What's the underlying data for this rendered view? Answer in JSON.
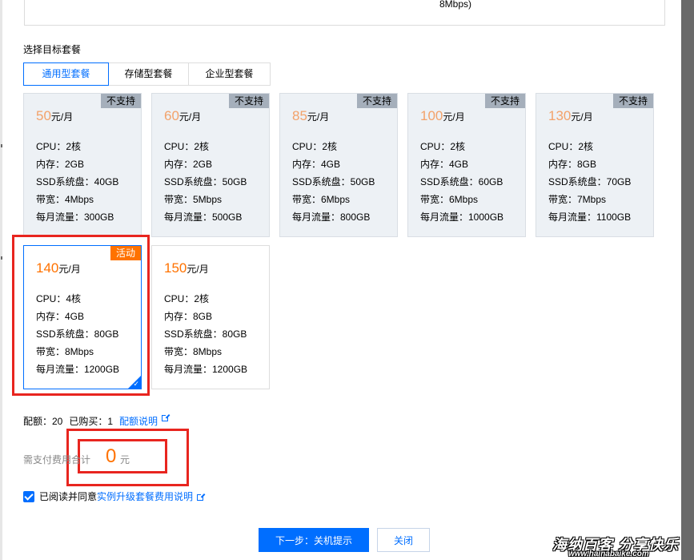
{
  "top_box": {
    "text": "8Mbps)"
  },
  "section_label": "选择目标套餐",
  "tabs": [
    {
      "label": "通用型套餐",
      "active": true
    },
    {
      "label": "存储型套餐",
      "active": false
    },
    {
      "label": "企业型套餐",
      "active": false
    }
  ],
  "plans": [
    {
      "price": "50",
      "unit": "元/月",
      "badge": "不支持",
      "cpu": "CPU：2核",
      "mem": "内存：2GB",
      "ssd": "SSD系统盘：40GB",
      "bw": "带宽：4Mbps",
      "traffic": "每月流量：300GB",
      "state": "disabled"
    },
    {
      "price": "60",
      "unit": "元/月",
      "badge": "不支持",
      "cpu": "CPU：2核",
      "mem": "内存：2GB",
      "ssd": "SSD系统盘：50GB",
      "bw": "带宽：5Mbps",
      "traffic": "每月流量：500GB",
      "state": "disabled"
    },
    {
      "price": "85",
      "unit": "元/月",
      "badge": "不支持",
      "cpu": "CPU：2核",
      "mem": "内存：4GB",
      "ssd": "SSD系统盘：50GB",
      "bw": "带宽：6Mbps",
      "traffic": "每月流量：800GB",
      "state": "disabled"
    },
    {
      "price": "100",
      "unit": "元/月",
      "badge": "不支持",
      "cpu": "CPU：2核",
      "mem": "内存：4GB",
      "ssd": "SSD系统盘：60GB",
      "bw": "带宽：6Mbps",
      "traffic": "每月流量：1000GB",
      "state": "disabled"
    },
    {
      "price": "130",
      "unit": "元/月",
      "badge": "不支持",
      "cpu": "CPU：2核",
      "mem": "内存：8GB",
      "ssd": "SSD系统盘：70GB",
      "bw": "带宽：7Mbps",
      "traffic": "每月流量：1100GB",
      "state": "disabled"
    },
    {
      "price": "140",
      "unit": "元/月",
      "badge": "活动",
      "cpu": "CPU：4核",
      "mem": "内存：4GB",
      "ssd": "SSD系统盘：80GB",
      "bw": "带宽：8Mbps",
      "traffic": "每月流量：1200GB",
      "state": "selected"
    },
    {
      "price": "150",
      "unit": "元/月",
      "badge": "",
      "cpu": "CPU：2核",
      "mem": "内存：8GB",
      "ssd": "SSD系统盘：80GB",
      "bw": "带宽：8Mbps",
      "traffic": "每月流量：1200GB",
      "state": "normal"
    }
  ],
  "quota": {
    "quota_text": "配额：20",
    "bought_text": "已购买：1",
    "link_text": "配额说明"
  },
  "total": {
    "label": "需支付费用合计",
    "amount": "0",
    "unit": "元"
  },
  "agreement": {
    "checked": true,
    "text": "已阅读并同意",
    "link_text": "实例升级套餐费用说明"
  },
  "buttons": {
    "next": "下一步：关机提示",
    "close": "关闭"
  },
  "watermark": {
    "title": "海纳百客 分享快乐",
    "url": "www.hainabaike.com"
  },
  "colors": {
    "accent": "#006eff",
    "price": "#ff7200",
    "highlight": "#e8251f",
    "disabled_bg": "#edf1f5"
  }
}
